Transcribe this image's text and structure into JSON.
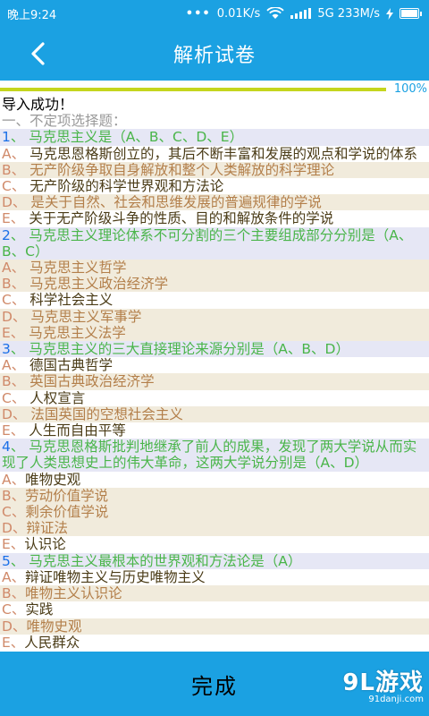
{
  "status": {
    "time": "晚上9:24",
    "dots": "•••",
    "speed": "0.01K/s",
    "network": "5G 233M/s"
  },
  "header": {
    "title": "解析试卷"
  },
  "progress": {
    "label": "100%",
    "value": 1.0
  },
  "content": {
    "import_msg": "导入成功！",
    "section": "一、不定项选择题：",
    "questions": [
      {
        "num": "1",
        "text": "、 马克思主义是（A、B、C、D、E）",
        "options": [
          {
            "letter": "A、",
            "text": " 马克思恩格斯创立的，其后不断丰富和发展的观点和学说的体系"
          },
          {
            "letter": "B、",
            "text": " 无产阶级争取自身解放和整个人类解放的科学理论"
          },
          {
            "letter": "C、",
            "text": " 无产阶级的科学世界观和方法论"
          },
          {
            "letter": "D、",
            "text": " 是关于自然、社会和思维发展的普遍规律的学说"
          },
          {
            "letter": "E、",
            "text": " 关于无产阶级斗争的性质、目的和解放条件的学说"
          }
        ]
      },
      {
        "num": "2",
        "text": "、 马克思主义理论体系不可分割的三个主要组成部分分别是（A、B、C）",
        "options": [
          {
            "letter": "A、",
            "text": " 马克思主义哲学"
          },
          {
            "letter": "B、",
            "text": " 马克思主义政治经济学"
          },
          {
            "letter": "C、",
            "text": " 科学社会主义"
          },
          {
            "letter": "D、",
            "text": " 马克思主义军事学"
          },
          {
            "letter": "E、",
            "text": " 马克思主义法学"
          }
        ]
      },
      {
        "num": "3",
        "text": "、 马克思主义的三大直接理论来源分别是（A、B、D）",
        "options": [
          {
            "letter": "A、",
            "text": " 德国古典哲学"
          },
          {
            "letter": "B、",
            "text": " 英国古典政治经济学"
          },
          {
            "letter": "C、",
            "text": " 人权宣言"
          },
          {
            "letter": "D、",
            "text": " 法国英国的空想社会主义"
          },
          {
            "letter": "E、",
            "text": " 人生而自由平等"
          }
        ]
      },
      {
        "num": "4",
        "text": "、 马克思恩格斯批判地继承了前人的成果，发现了两大学说从而实现了人类思想史上的伟大革命，这两大学说分别是（A、D）",
        "options": [
          {
            "letter": "A、",
            "text": "唯物史观"
          },
          {
            "letter": "B、",
            "text": "劳动价值学说"
          },
          {
            "letter": "C、",
            "text": "剩余价值学说"
          },
          {
            "letter": "D、",
            "text": "辩证法"
          },
          {
            "letter": "E、",
            "text": "认识论"
          }
        ]
      },
      {
        "num": "5",
        "text": "、 马克思主义最根本的世界观和方法论是（A）",
        "options": [
          {
            "letter": "A、",
            "text": "辩证唯物主义与历史唯物主义"
          },
          {
            "letter": "B、",
            "text": "唯物主义认识论"
          },
          {
            "letter": "C、",
            "text": "实践"
          },
          {
            "letter": "D、",
            "text": "唯物史观"
          },
          {
            "letter": "E、",
            "text": "人民群众"
          }
        ]
      }
    ]
  },
  "footer": {
    "done_label": "完成"
  },
  "watermark": {
    "brand": "9L游戏",
    "url": "91danji.com"
  },
  "colors": {
    "primary": "#1ba1e2",
    "progress": "#c5d61e",
    "question_bg": "#e6e7f5",
    "question_num": "#1a6fe8",
    "question_text": "#4ab54a",
    "option_letter": "#d08a6a",
    "option_text": "#4a3b16"
  }
}
